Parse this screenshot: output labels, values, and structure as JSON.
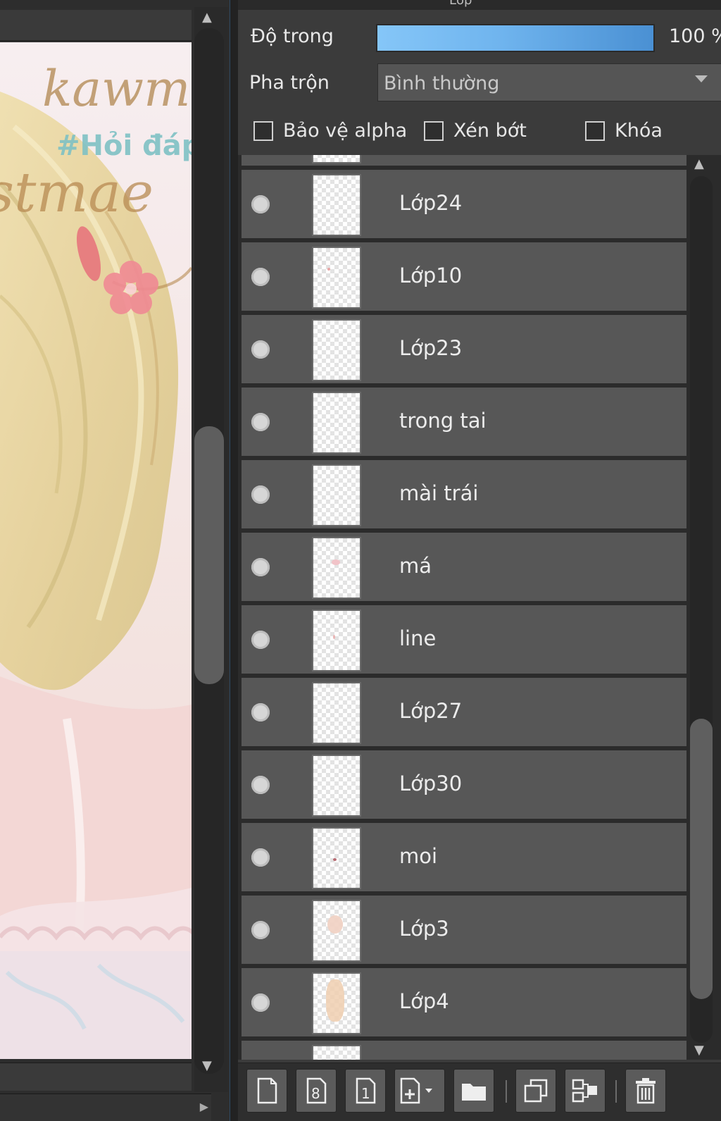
{
  "panel": {
    "title": "Lớp"
  },
  "opacity": {
    "label": "Độ trong",
    "value": "100 %",
    "level": 1.0
  },
  "blend": {
    "label": "Pha trộn",
    "value": "Bình thường"
  },
  "options": {
    "protect_alpha": "Bảo vệ alpha",
    "clipping": "Xén bớt",
    "lock": "Khóa"
  },
  "layers": [
    {
      "name": "Lớp24",
      "visible": true
    },
    {
      "name": "Lớp10",
      "visible": true
    },
    {
      "name": "Lớp23",
      "visible": true
    },
    {
      "name": "trong tai",
      "visible": true
    },
    {
      "name": "mài trái",
      "visible": true
    },
    {
      "name": "má",
      "visible": true
    },
    {
      "name": "line",
      "visible": true
    },
    {
      "name": "Lớp27",
      "visible": true
    },
    {
      "name": "Lớp30",
      "visible": true
    },
    {
      "name": "moi",
      "visible": true
    },
    {
      "name": "Lớp3",
      "visible": true
    },
    {
      "name": "Lớp4",
      "visible": true
    }
  ],
  "canvas": {
    "artwork_text": [
      "kawm",
      "#Hỏi đáp",
      "stmae"
    ]
  },
  "colors": {
    "accent": "#6fb4ee",
    "panel_bg": "#3b3b3b",
    "row_bg": "#575757"
  },
  "toolbar": {
    "icons": [
      "new-layer-icon",
      "new-8bit-layer-icon",
      "new-1bit-layer-icon",
      "add-layer-dropdown-icon",
      "new-folder-icon",
      "duplicate-layer-icon",
      "merge-down-icon",
      "delete-layer-icon"
    ],
    "button_glyphs": {
      "eight": "8",
      "one": "1"
    }
  }
}
